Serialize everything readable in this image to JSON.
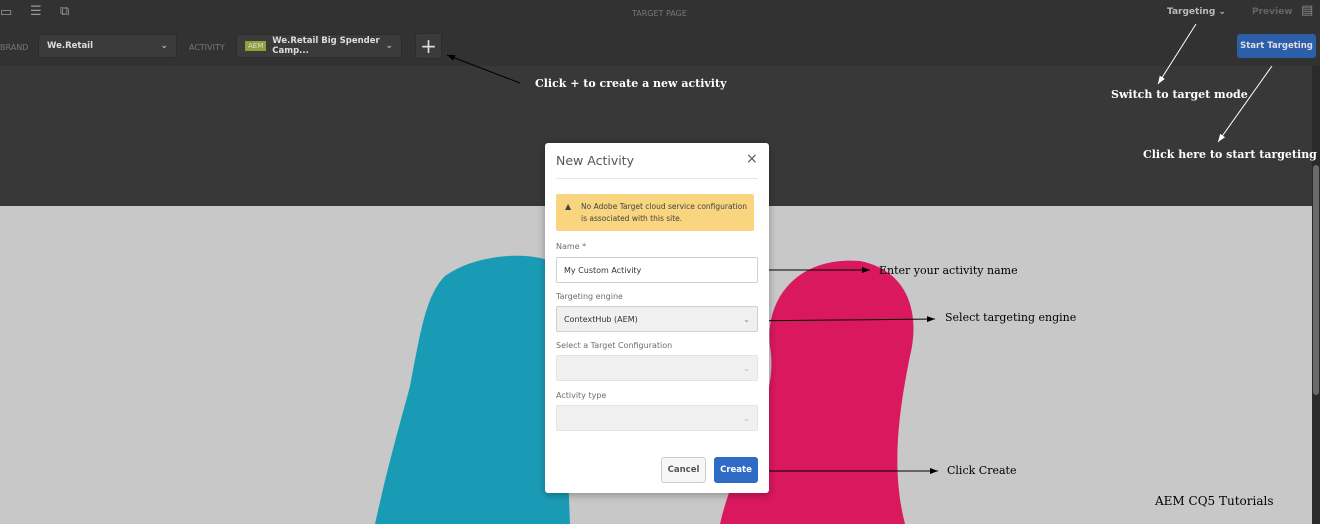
{
  "topbar": {
    "title": "TARGET PAGE",
    "mode": "Targeting",
    "preview": "Preview"
  },
  "toolbar": {
    "brand_label": "BRAND",
    "brand_value": "We.Retail",
    "activity_label": "ACTIVITY",
    "activity_badge": "AEM",
    "activity_value": "We.Retail Big Spender Camp...",
    "add_label": "+",
    "start_button": "Start Targeting"
  },
  "dialog": {
    "title": "New Activity",
    "close": "×",
    "warning": "No Adobe Target cloud service configuration is associated with this site.",
    "name_label": "Name *",
    "name_value": "My Custom Activity",
    "engine_label": "Targeting engine",
    "engine_value": "ContextHub (AEM)",
    "config_label": "Select a Target Configuration",
    "config_value": "",
    "type_label": "Activity type",
    "type_value": "",
    "cancel": "Cancel",
    "create": "Create"
  },
  "annotations": {
    "add": "Click + to create a new activity",
    "switch": "Switch to target mode",
    "start": "Click here to start targeting",
    "name": "Enter your activity name",
    "engine": "Select targeting engine",
    "create": "Click Create",
    "credit": "AEM CQ5 Tutorials"
  },
  "colors": {
    "accent": "#2d6bc4",
    "warning": "#f8d57e",
    "teal": "#1a9bb5",
    "pink": "#d9185e"
  }
}
